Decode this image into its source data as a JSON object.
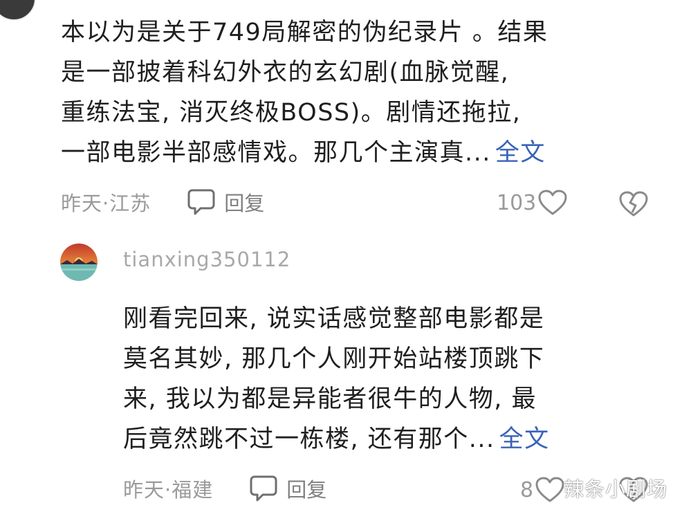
{
  "comment1": {
    "lines": [
      "本以为是关于749局解密的伪纪录片 。结果",
      "是一部披着科幻外衣的玄幻剧(血脉觉醒,",
      "重练法宝, 消灭终极BOSS)。剧情还拖拉,",
      "一部电影半部感情戏。那几个主演真..."
    ],
    "more_label": "全文",
    "time": "昨天·江苏",
    "reply_label": "回复",
    "like_count": "103"
  },
  "comment2": {
    "username": "tianxing350112",
    "lines": [
      "刚看完回来, 说实话感觉整部电影都是",
      "莫名其妙, 那几个人刚开始站楼顶跳下",
      "来, 我以为都是异能者很牛的人物, 最",
      "后竟然跳不过一栋楼, 还有那个..."
    ],
    "more_label": "全文",
    "time": "昨天·福建",
    "reply_label": "回复",
    "like_count": "8"
  },
  "watermark": "辣条小剧场",
  "colors": {
    "link": "#3a63b8",
    "meta": "#9a9a9a",
    "text": "#1f1f1f"
  }
}
